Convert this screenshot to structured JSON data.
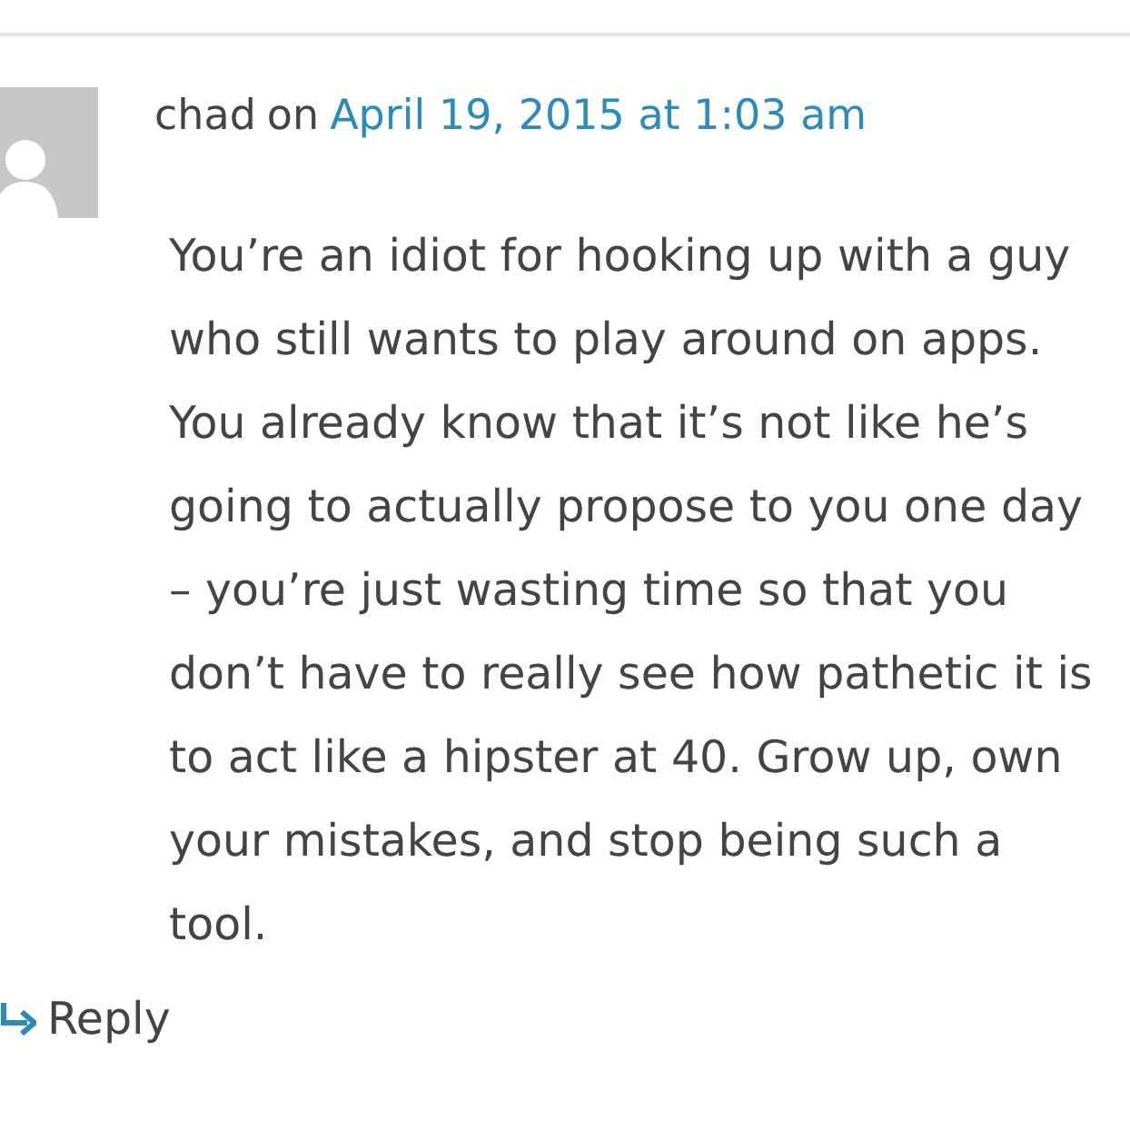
{
  "comment": {
    "author": "chad",
    "on_word": "on",
    "date": "April 19, 2015 at 1:03 am",
    "text": "You’re an idiot for hooking up with a guy who still wants to play around on apps. You already know that it’s not like he’s going to actually propose to you one day – you’re just wasting time so that you don’t have to really see how pathetic it is to act like a hipster at 40. Grow up, own your mistakes, and stop being such a tool.",
    "reply": "Reply"
  }
}
